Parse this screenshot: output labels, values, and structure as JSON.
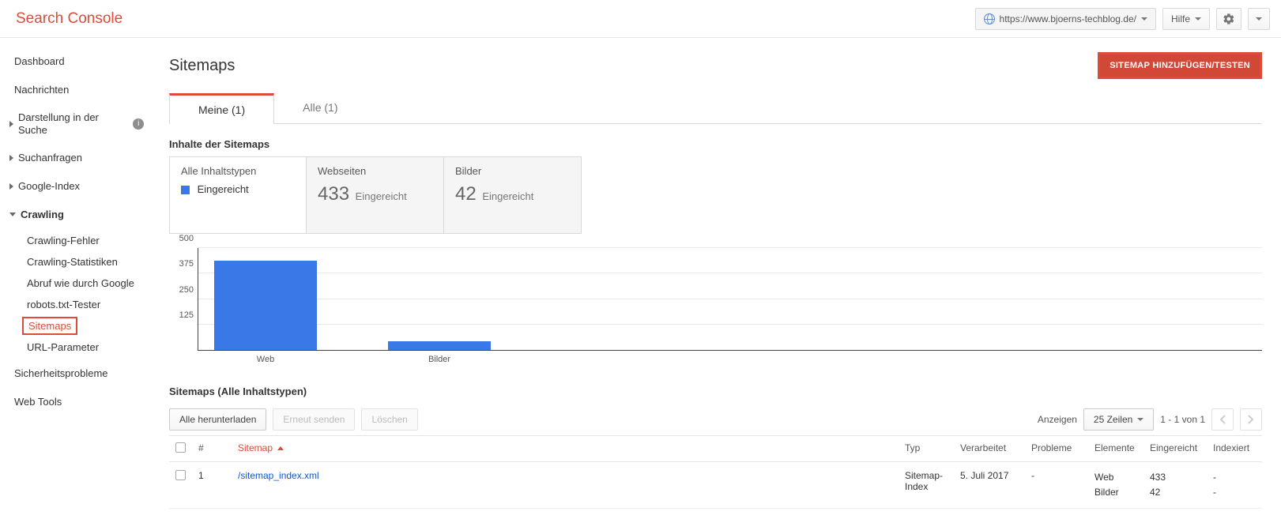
{
  "brand": "Search Console",
  "property": {
    "url": "https://www.bjoerns-techblog.de/"
  },
  "help_label": "Hilfe",
  "sidebar": {
    "items": [
      {
        "label": "Dashboard",
        "expandable": false
      },
      {
        "label": "Nachrichten",
        "expandable": false
      },
      {
        "label": "Darstellung in der Suche",
        "expandable": true,
        "open": false,
        "info": true
      },
      {
        "label": "Suchanfragen",
        "expandable": true,
        "open": false
      },
      {
        "label": "Google-Index",
        "expandable": true,
        "open": false
      },
      {
        "label": "Crawling",
        "expandable": true,
        "open": true,
        "bold": true,
        "children": [
          {
            "label": "Crawling-Fehler"
          },
          {
            "label": "Crawling-Statistiken"
          },
          {
            "label": "Abruf wie durch Google"
          },
          {
            "label": "robots.txt-Tester"
          },
          {
            "label": "Sitemaps",
            "active": true
          },
          {
            "label": "URL-Parameter"
          }
        ]
      },
      {
        "label": "Sicherheitsprobleme",
        "expandable": false
      },
      {
        "label": "Web Tools",
        "expandable": false
      }
    ]
  },
  "page": {
    "title": "Sitemaps",
    "primary_action": "SITEMAP HINZUFÜGEN/TESTEN"
  },
  "tabs": [
    {
      "label": "Meine (1)",
      "active": true
    },
    {
      "label": "Alle (1)",
      "active": false
    }
  ],
  "content_header": "Inhalte der Sitemaps",
  "summary": {
    "all_types_label": "Alle Inhaltstypen",
    "submitted_label": "Eingereicht",
    "boxes": [
      {
        "title": "Webseiten",
        "value": "433",
        "suffix": "Eingereicht"
      },
      {
        "title": "Bilder",
        "value": "42",
        "suffix": "Eingereicht"
      }
    ]
  },
  "chart_data": {
    "type": "bar",
    "categories": [
      "Web",
      "Bilder"
    ],
    "values": [
      433,
      42
    ],
    "ylim": [
      0,
      500
    ],
    "yticks": [
      125,
      250,
      375,
      500
    ],
    "xlabel": "",
    "ylabel": "",
    "title": ""
  },
  "table_section_title": "Sitemaps (Alle Inhaltstypen)",
  "toolbar": {
    "download_all": "Alle herunterladen",
    "resend": "Erneut senden",
    "delete": "Löschen",
    "show_label": "Anzeigen",
    "rows_option": "25 Zeilen",
    "range": "1 - 1 von 1"
  },
  "table": {
    "columns": {
      "index": "#",
      "sitemap": "Sitemap",
      "type": "Typ",
      "processed": "Verarbeitet",
      "problems": "Probleme",
      "elements": "Elemente",
      "submitted": "Eingereicht",
      "indexed": "Indexiert"
    },
    "rows": [
      {
        "index": "1",
        "sitemap": "/sitemap_index.xml",
        "type": "Sitemap-Index",
        "processed": "5. Juli 2017",
        "problems": "-",
        "elements": [
          "Web",
          "Bilder"
        ],
        "submitted": [
          "433",
          "42"
        ],
        "indexed": [
          "-",
          "-"
        ]
      }
    ]
  }
}
